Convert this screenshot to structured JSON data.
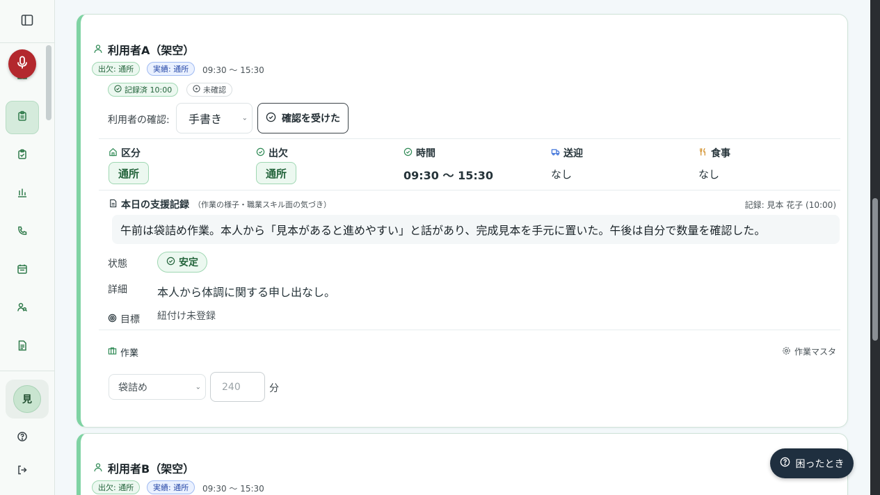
{
  "colors": {
    "accent": "#7fd3a3",
    "mic": "#b3282d",
    "help": "#1f2f3f"
  },
  "sidebar": {
    "avatar_initial": "見",
    "items": [
      "sidebar-toggle-icon",
      "dashboard-icon",
      "clipboard-icon",
      "clipboard-check-icon",
      "bar-chart-icon",
      "phone-icon",
      "calendar-icon",
      "users-icon",
      "document-icon",
      "help-circle-icon",
      "logout-icon"
    ]
  },
  "card_a": {
    "name": "利用者A（架空）",
    "attendance_badge": "出欠: 通所",
    "actual_badge": "実績: 通所",
    "time_range": "09:30 〜 15:30",
    "recorded_badge": "記録済 10:00",
    "unconfirmed_badge": "未確認",
    "confirm_label": "利用者の確認:",
    "confirm_method": "手書き",
    "confirm_button": "確認を受けた",
    "columns": {
      "category_head": "区分",
      "category_val": "通所",
      "attendance_head": "出欠",
      "attendance_val": "通所",
      "time_head": "時間",
      "time_val": "09:30 〜 15:30",
      "transport_head": "送迎",
      "transport_val": "なし",
      "meal_head": "食事",
      "meal_val": "なし"
    },
    "record_title": "本日の支援記録",
    "record_subtitle": "（作業の様子・職業スキル面の気づき）",
    "record_meta": "記録: 見本 花子 (10:00)",
    "record_text": "午前は袋詰め作業。本人から「見本があると進めやすい」と話があり、完成見本を手元に置いた。午後は自分で数量を確認した。",
    "status_label": "状態",
    "status_value": "安定",
    "detail_label": "詳細",
    "detail_value": "本人から体調に関する申し出なし。",
    "goal_label": "目標",
    "goal_value": "紐付け未登録",
    "work_label": "作業",
    "work_master": "作業マスタ",
    "work_select": "袋詰め",
    "work_minutes_placeholder": "240",
    "work_minutes_unit": "分"
  },
  "card_b": {
    "name": "利用者B（架空）",
    "attendance_badge": "出欠: 通所",
    "actual_badge": "実績: 通所",
    "time_range": "09:30 〜 15:30"
  },
  "help_button": "困ったとき"
}
